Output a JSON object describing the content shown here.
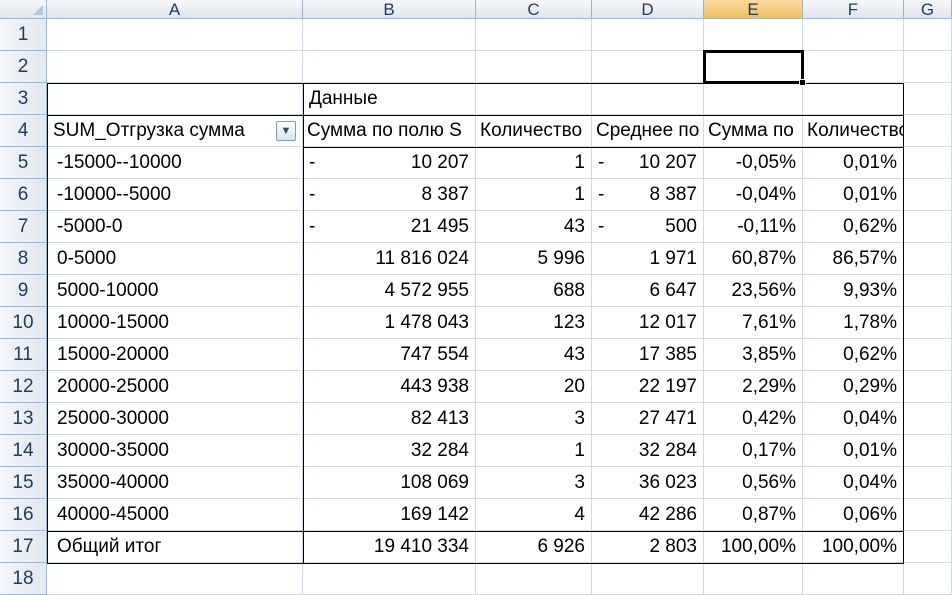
{
  "columns": [
    "A",
    "B",
    "C",
    "D",
    "E",
    "F",
    "G"
  ],
  "rows": [
    "1",
    "2",
    "3",
    "4",
    "5",
    "6",
    "7",
    "8",
    "9",
    "10",
    "11",
    "12",
    "13",
    "14",
    "15",
    "16",
    "17",
    "18"
  ],
  "selected_column": "E",
  "pivot": {
    "data_caption": "Данные",
    "row_field": "SUM_Отгрузка сумма",
    "filter_icon": "dropdown-arrow-icon",
    "value_headers": [
      "Сумма по полю S",
      "Количество",
      "Среднее по",
      "Сумма по",
      "Количество по"
    ],
    "rows": [
      {
        "label": "-15000--10000",
        "sum": "10 207",
        "sum_neg": true,
        "count": "1",
        "avg": "10 207",
        "avg_neg": true,
        "pct_sum": "-0,05%",
        "pct_count": "0,01%"
      },
      {
        "label": "-10000--5000",
        "sum": "8 387",
        "sum_neg": true,
        "count": "1",
        "avg": "8 387",
        "avg_neg": true,
        "pct_sum": "-0,04%",
        "pct_count": "0,01%"
      },
      {
        "label": "-5000-0",
        "sum": "21 495",
        "sum_neg": true,
        "count": "43",
        "avg": "500",
        "avg_neg": true,
        "pct_sum": "-0,11%",
        "pct_count": "0,62%"
      },
      {
        "label": "0-5000",
        "sum": "11 816 024",
        "sum_neg": false,
        "count": "5 996",
        "avg": "1 971",
        "avg_neg": false,
        "pct_sum": "60,87%",
        "pct_count": "86,57%"
      },
      {
        "label": "5000-10000",
        "sum": "4 572 955",
        "sum_neg": false,
        "count": "688",
        "avg": "6 647",
        "avg_neg": false,
        "pct_sum": "23,56%",
        "pct_count": "9,93%"
      },
      {
        "label": "10000-15000",
        "sum": "1 478 043",
        "sum_neg": false,
        "count": "123",
        "avg": "12 017",
        "avg_neg": false,
        "pct_sum": "7,61%",
        "pct_count": "1,78%"
      },
      {
        "label": "15000-20000",
        "sum": "747 554",
        "sum_neg": false,
        "count": "43",
        "avg": "17 385",
        "avg_neg": false,
        "pct_sum": "3,85%",
        "pct_count": "0,62%"
      },
      {
        "label": "20000-25000",
        "sum": "443 938",
        "sum_neg": false,
        "count": "20",
        "avg": "22 197",
        "avg_neg": false,
        "pct_sum": "2,29%",
        "pct_count": "0,29%"
      },
      {
        "label": "25000-30000",
        "sum": "82 413",
        "sum_neg": false,
        "count": "3",
        "avg": "27 471",
        "avg_neg": false,
        "pct_sum": "0,42%",
        "pct_count": "0,04%"
      },
      {
        "label": "30000-35000",
        "sum": "32 284",
        "sum_neg": false,
        "count": "1",
        "avg": "32 284",
        "avg_neg": false,
        "pct_sum": "0,17%",
        "pct_count": "0,01%"
      },
      {
        "label": "35000-40000",
        "sum": "108 069",
        "sum_neg": false,
        "count": "3",
        "avg": "36 023",
        "avg_neg": false,
        "pct_sum": "0,56%",
        "pct_count": "0,04%"
      },
      {
        "label": "40000-45000",
        "sum": "169 142",
        "sum_neg": false,
        "count": "4",
        "avg": "42 286",
        "avg_neg": false,
        "pct_sum": "0,87%",
        "pct_count": "0,06%"
      }
    ],
    "total": {
      "label": "Общий итог",
      "sum": "19 410 334",
      "count": "6 926",
      "avg": "2 803",
      "pct_sum": "100,00%",
      "pct_count": "100,00%"
    }
  }
}
